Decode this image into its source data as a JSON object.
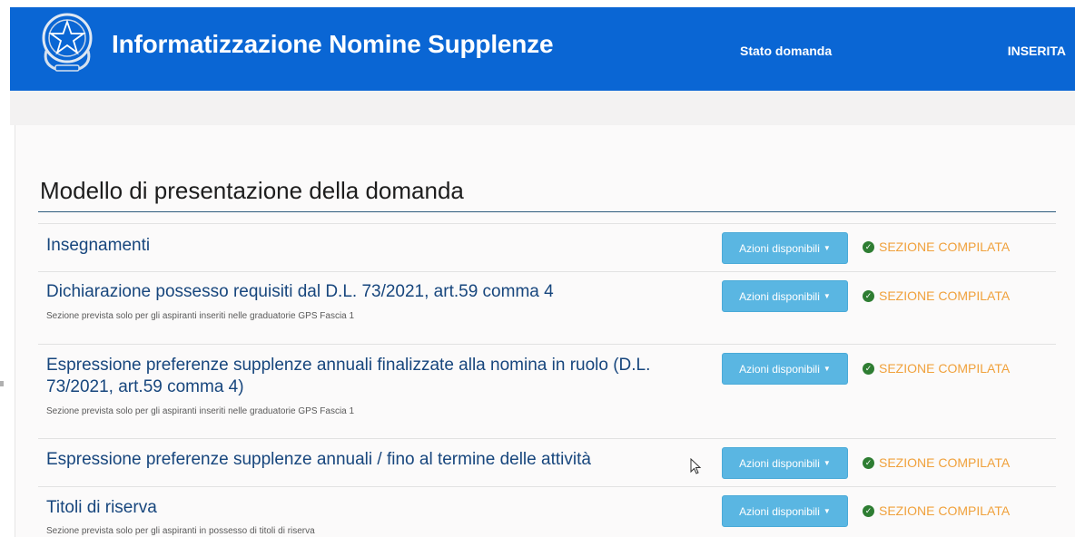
{
  "header": {
    "title": "Informatizzazione Nomine Supplenze",
    "stato_label": "Stato domanda",
    "stato_value": "INSERITA",
    "logo_icon": "italian-republic-emblem-icon"
  },
  "page": {
    "title": "Modello di presentazione della domanda"
  },
  "sections": [
    {
      "title": "Insegnamenti",
      "subtitle": "",
      "button_label": "Azioni disponibili",
      "status": "SEZIONE COMPILATA"
    },
    {
      "title": "Dichiarazione possesso requisiti dal D.L. 73/2021, art.59 comma 4",
      "subtitle": "Sezione prevista solo per gli aspiranti inseriti nelle graduatorie GPS Fascia 1",
      "button_label": "Azioni disponibili",
      "status": "SEZIONE COMPILATA"
    },
    {
      "title": "Espressione preferenze supplenze annuali finalizzate alla nomina in ruolo (D.L. 73/2021, art.59 comma 4)",
      "subtitle": "Sezione prevista solo per gli aspiranti inseriti nelle graduatorie GPS Fascia 1",
      "button_label": "Azioni disponibili",
      "status": "SEZIONE COMPILATA"
    },
    {
      "title": "Espressione preferenze supplenze annuali / fino al termine delle attività",
      "subtitle": "",
      "button_label": "Azioni disponibili",
      "status": "SEZIONE COMPILATA"
    },
    {
      "title": "Titoli di riserva",
      "subtitle": "Sezione prevista solo per gli aspiranti in possesso di titoli di riserva",
      "button_label": "Azioni disponibili",
      "status": "SEZIONE COMPILATA"
    }
  ],
  "colors": {
    "header_bg": "#0a66d4",
    "section_title": "#17467d",
    "button_bg": "#5ab6e2",
    "status_text": "#f0a13c",
    "check_green": "#2e7d32"
  }
}
